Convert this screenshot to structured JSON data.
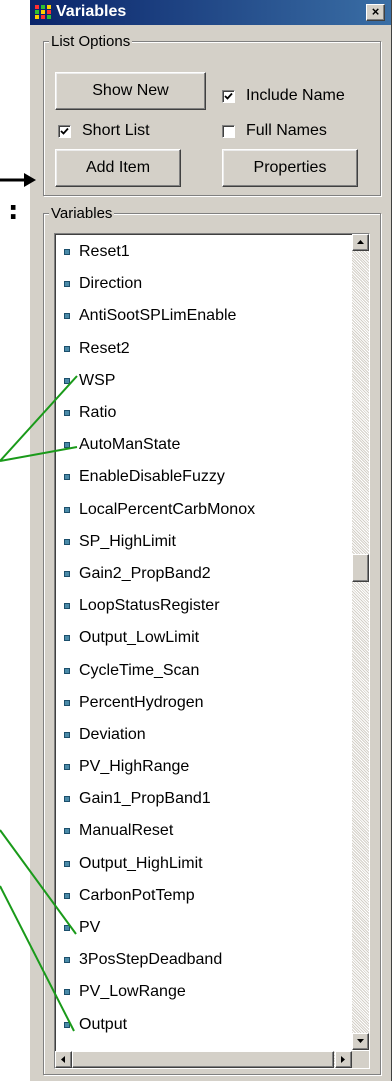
{
  "window": {
    "title": "Variables",
    "close_glyph": "×"
  },
  "list_options": {
    "group_label": "List Options",
    "show_new_label": "Show New",
    "include_name_label": "Include Name",
    "include_name_checked": true,
    "short_list_label": "Short List",
    "short_list_checked": true,
    "full_names_label": "Full Names",
    "full_names_checked": false,
    "add_item_label": "Add Item",
    "properties_label": "Properties"
  },
  "variables": {
    "group_label": "Variables",
    "items": [
      "Reset1",
      "Direction",
      "AntiSootSPLimEnable",
      "Reset2",
      "WSP",
      "Ratio",
      "AutoManState",
      "EnableDisableFuzzy",
      "LocalPercentCarbMonox",
      "SP_HighLimit",
      "Gain2_PropBand2",
      "LoopStatusRegister",
      "Output_LowLimit",
      "CycleTime_Scan",
      "PercentHydrogen",
      "Deviation",
      "PV_HighRange",
      "Gain1_PropBand1",
      "ManualReset",
      "Output_HighLimit",
      "CarbonPotTemp",
      "PV",
      "3PosStepDeadband",
      "PV_LowRange",
      "Output"
    ]
  },
  "annotation": {
    "colon_mark": ":",
    "line_color": "#1a9a1a"
  },
  "colors": {
    "titlebar_start": "#0a246a",
    "titlebar_end": "#3a6ea5",
    "window_face": "#d4d0c8"
  }
}
